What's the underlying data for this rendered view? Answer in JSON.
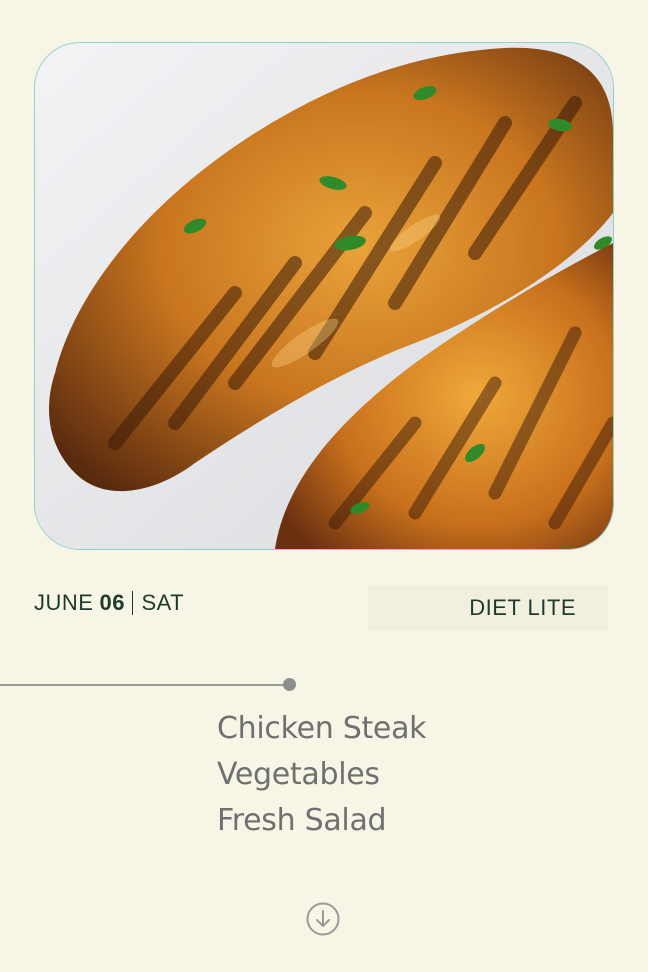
{
  "hero": {
    "image_description_icon": "grilled-chicken-photo"
  },
  "date": {
    "month": "JUNE",
    "day": "06",
    "weekday": "SAT"
  },
  "plan": {
    "label": "DIET LITE"
  },
  "menu": {
    "items": [
      "Chicken Steak",
      "Vegetables",
      "Fresh Salad"
    ]
  },
  "controls": {
    "scroll_icon": "arrow-down-circle-icon"
  },
  "colors": {
    "background": "#f6f5e6",
    "text_dark": "#1f3a2c",
    "menu_text": "#707070",
    "card_border": "#8fd0c8"
  }
}
